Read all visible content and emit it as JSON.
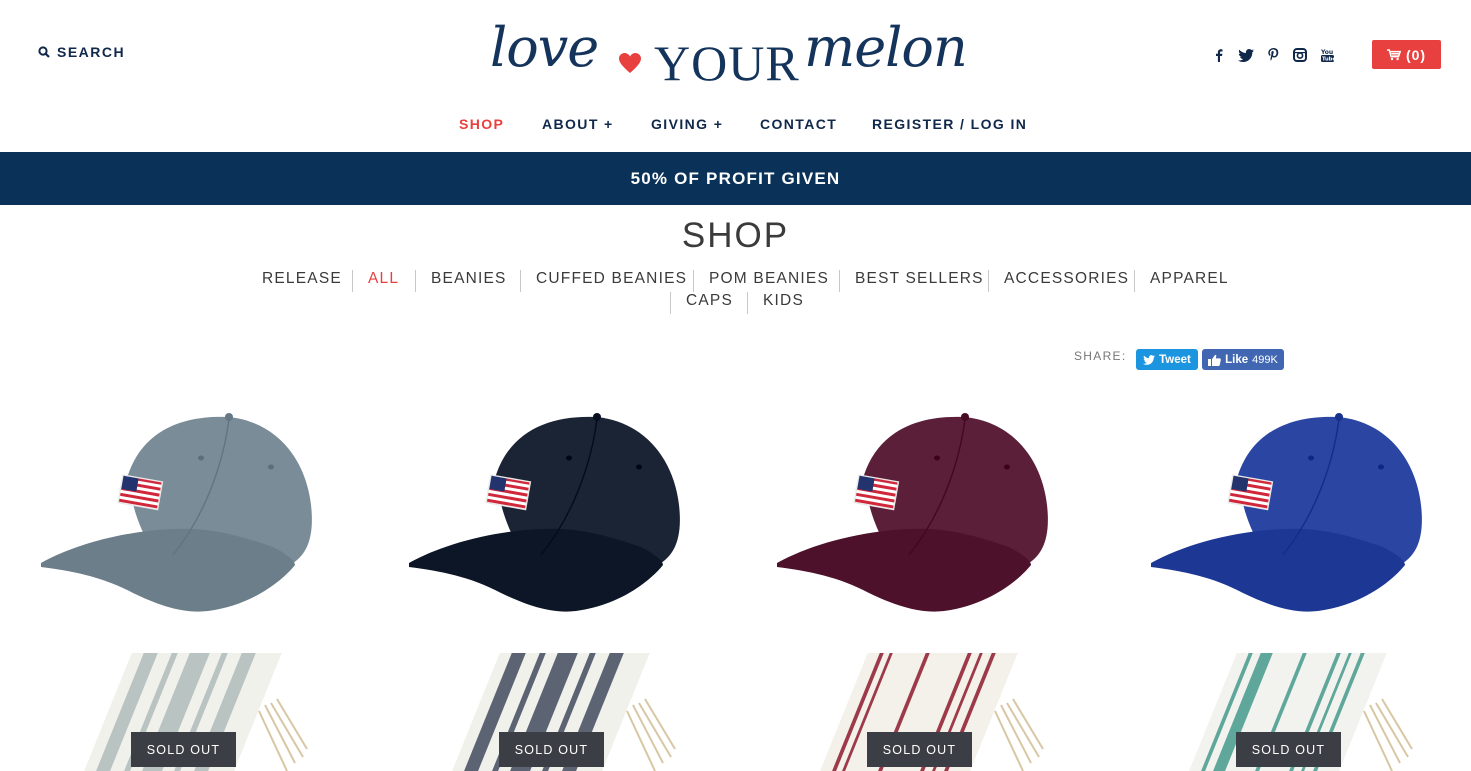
{
  "header": {
    "search_label": "SEARCH",
    "logo": {
      "love": "love",
      "your": "YOUR",
      "melon": "melon"
    },
    "social_icons": [
      "facebook-icon",
      "twitter-icon",
      "pinterest-icon",
      "instagram-icon",
      "youtube-icon"
    ],
    "cart_label": "(0)"
  },
  "nav": {
    "items": [
      {
        "label": "SHOP",
        "active": true
      },
      {
        "label": "ABOUT +"
      },
      {
        "label": "GIVING +"
      },
      {
        "label": "CONTACT"
      },
      {
        "label": "REGISTER / LOG IN"
      }
    ]
  },
  "banner": {
    "text": "50% OF PROFIT GIVEN"
  },
  "shop": {
    "title": "SHOP",
    "categories": [
      {
        "label": "RELEASE"
      },
      {
        "label": "ALL",
        "active": true
      },
      {
        "label": "BEANIES"
      },
      {
        "label": "CUFFED BEANIES"
      },
      {
        "label": "POM BEANIES"
      },
      {
        "label": "BEST SELLERS"
      },
      {
        "label": "ACCESSORIES"
      },
      {
        "label": "APPAREL"
      },
      {
        "label": "CAPS"
      },
      {
        "label": "KIDS"
      }
    ]
  },
  "share": {
    "label": "SHARE:",
    "tweet_label": "Tweet",
    "like_label": "Like",
    "like_count": "499K"
  },
  "products": {
    "caps": [
      {
        "color": "#7a8c98"
      },
      {
        "color": "#1b2434"
      },
      {
        "color": "#5c1f3a"
      },
      {
        "color": "#2a45a2"
      }
    ],
    "towels": [
      {
        "stripe": "#b9c3c2",
        "sold_out_label": "SOLD OUT"
      },
      {
        "stripe": "#5c6474",
        "sold_out_label": "SOLD OUT"
      },
      {
        "stripe": "#9c3a4a",
        "sold_out_label": "SOLD OUT"
      },
      {
        "stripe": "#5fa79a",
        "sold_out_label": "SOLD OUT"
      }
    ]
  },
  "colors": {
    "accent": "#e8403f",
    "navy": "#0a3157"
  }
}
